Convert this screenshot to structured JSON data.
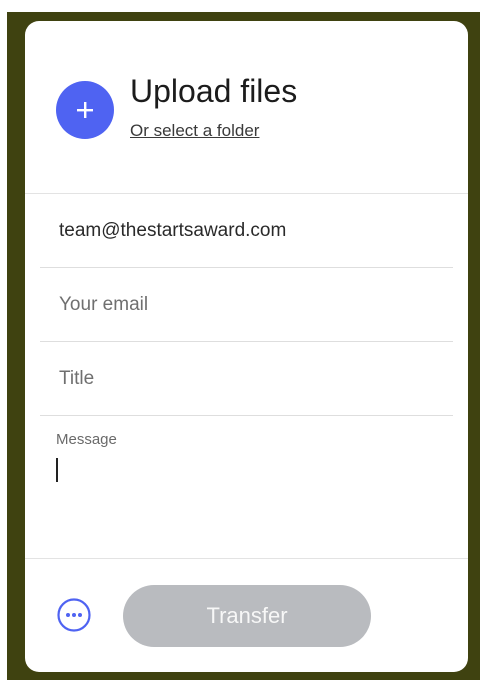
{
  "header": {
    "title": "Upload files",
    "folder_link": "Or select a folder",
    "add_icon": "plus-icon"
  },
  "fields": {
    "recipient": "team@thestartsaward.com",
    "your_email_placeholder": "Your email",
    "title_placeholder": "Title",
    "message_label": "Message"
  },
  "footer": {
    "options_icon": "more-options-icon",
    "transfer_label": "Transfer"
  },
  "colors": {
    "accent": "#4f63f2",
    "frame": "#3f4210",
    "disabled_button": "#b9bbbf"
  }
}
